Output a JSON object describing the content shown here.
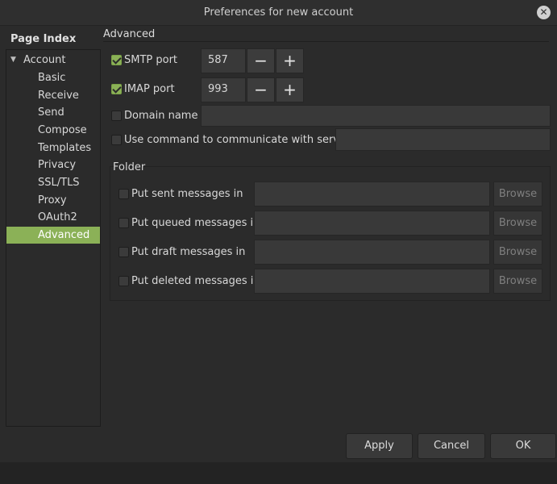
{
  "window": {
    "title": "Preferences for new account"
  },
  "page_index": {
    "header": "Page Index",
    "items": [
      {
        "label": "Account",
        "expanded": true
      },
      {
        "label": "Basic"
      },
      {
        "label": "Receive"
      },
      {
        "label": "Send"
      },
      {
        "label": "Compose"
      },
      {
        "label": "Templates"
      },
      {
        "label": "Privacy"
      },
      {
        "label": "SSL/TLS"
      },
      {
        "label": "Proxy"
      },
      {
        "label": "OAuth2"
      },
      {
        "label": "Advanced",
        "selected": true
      }
    ]
  },
  "advanced": {
    "title": "Advanced",
    "smtp_port": {
      "label": "SMTP port",
      "checked": true,
      "value": "587"
    },
    "imap_port": {
      "label": "IMAP port",
      "checked": true,
      "value": "993"
    },
    "domain_name": {
      "label": "Domain name",
      "checked": false,
      "value": ""
    },
    "use_command": {
      "label": "Use command to communicate with server",
      "checked": false,
      "value": ""
    },
    "stepper": {
      "minus": "−",
      "plus": "+"
    }
  },
  "folder": {
    "title": "Folder",
    "browse_label": "Browse",
    "rows": [
      {
        "label": "Put sent messages in",
        "checked": false,
        "value": ""
      },
      {
        "label": "Put queued messages in",
        "checked": false,
        "value": ""
      },
      {
        "label": "Put draft messages in",
        "checked": false,
        "value": ""
      },
      {
        "label": "Put deleted messages in",
        "checked": false,
        "value": ""
      }
    ]
  },
  "buttons": {
    "apply": "Apply",
    "cancel": "Cancel",
    "ok": "OK"
  },
  "colors": {
    "accent": "#8bb157",
    "background": "#2b2b2b"
  },
  "icons": {
    "close": "close-icon",
    "expand": "triangle-down-icon",
    "check": "checkmark-icon"
  }
}
